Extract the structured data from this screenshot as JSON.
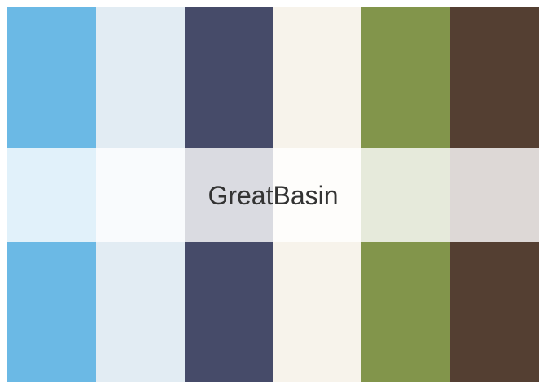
{
  "palette": {
    "name": "GreatBasin",
    "colors": [
      "#6BB9E5",
      "#E2ECF3",
      "#464B69",
      "#F7F3EB",
      "#82954B",
      "#543F32"
    ]
  }
}
